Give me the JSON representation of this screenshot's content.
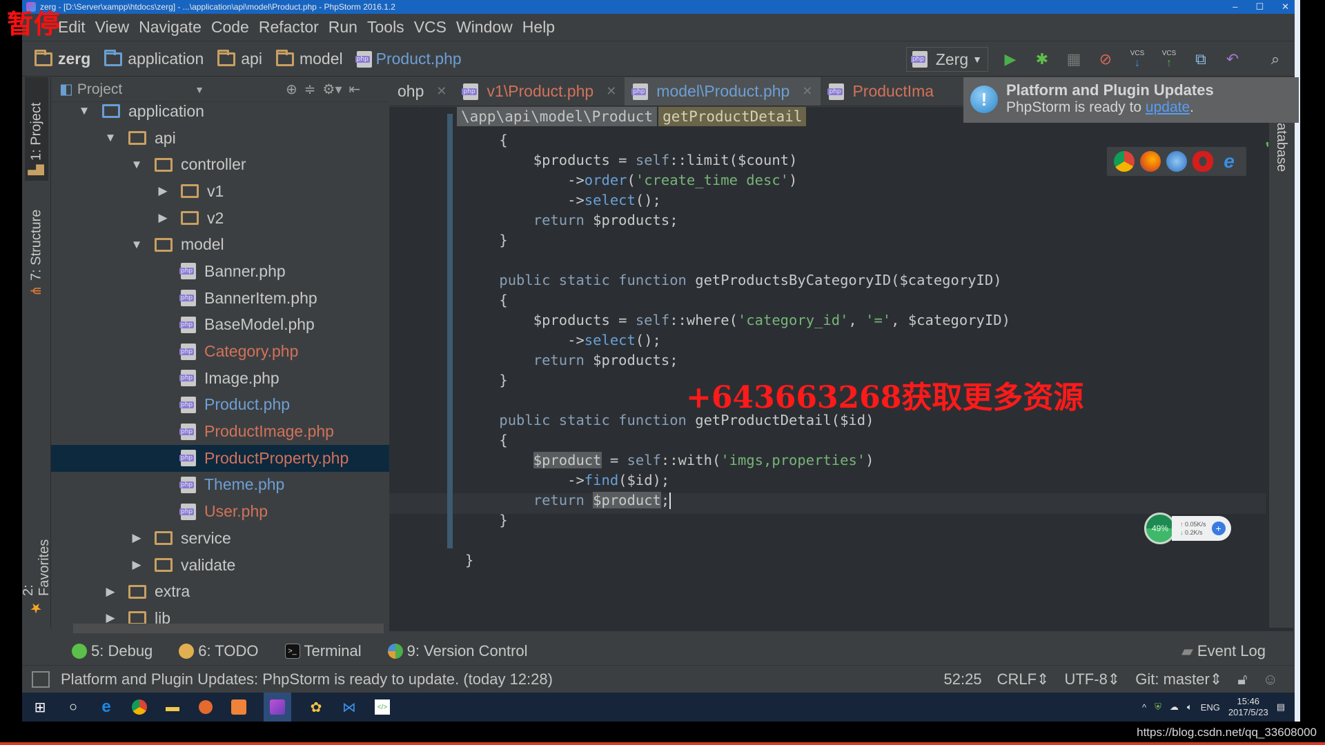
{
  "overlay": {
    "pause_label": "暂停",
    "promo_text": "+643663268获取更多资源",
    "url_watermark": "https://blog.csdn.net/qq_33608000"
  },
  "window": {
    "title": "zerg - [D:\\Server\\xampp\\htdocs\\zerg] - ...\\application\\api\\model\\Product.php - PhpStorm 2016.1.2",
    "controls": [
      "–",
      "☐",
      "✕"
    ]
  },
  "menu": [
    "Edit",
    "View",
    "Navigate",
    "Code",
    "Refactor",
    "Run",
    "Tools",
    "VCS",
    "Window",
    "Help"
  ],
  "breadcrumbs": [
    {
      "label": "zerg",
      "type": "folder"
    },
    {
      "label": "application",
      "type": "folder-blue"
    },
    {
      "label": "api",
      "type": "folder"
    },
    {
      "label": "model",
      "type": "folder"
    },
    {
      "label": "Product.php",
      "type": "file"
    }
  ],
  "toolbar": {
    "run_config": "Zerg",
    "icons": [
      "run-icon",
      "debug-icon",
      "coverage-icon",
      "stop-debug-icon",
      "vcs-update-icon",
      "vcs-commit-icon",
      "history-icon",
      "revert-icon",
      "search-icon"
    ],
    "vcs_label": "VCS"
  },
  "left_strip": {
    "project_tab": "1: Project",
    "structure_tab": "7: Structure",
    "favorites_tab": "2: Favorites"
  },
  "project_panel": {
    "title": "Project",
    "tree": [
      {
        "label": "application",
        "depth": 0,
        "arrow": "▼",
        "kind": "folder-blue",
        "status": "normal"
      },
      {
        "label": "api",
        "depth": 1,
        "arrow": "▼",
        "kind": "folder",
        "status": "normal"
      },
      {
        "label": "controller",
        "depth": 2,
        "arrow": "▼",
        "kind": "folder",
        "status": "normal"
      },
      {
        "label": "v1",
        "depth": 3,
        "arrow": "▶",
        "kind": "folder",
        "status": "normal"
      },
      {
        "label": "v2",
        "depth": 3,
        "arrow": "▶",
        "kind": "folder",
        "status": "normal"
      },
      {
        "label": "model",
        "depth": 2,
        "arrow": "▼",
        "kind": "folder",
        "status": "normal"
      },
      {
        "label": "Banner.php",
        "depth": 3,
        "arrow": "",
        "kind": "php",
        "status": "normal"
      },
      {
        "label": "BannerItem.php",
        "depth": 3,
        "arrow": "",
        "kind": "php",
        "status": "normal"
      },
      {
        "label": "BaseModel.php",
        "depth": 3,
        "arrow": "",
        "kind": "php",
        "status": "normal"
      },
      {
        "label": "Category.php",
        "depth": 3,
        "arrow": "",
        "kind": "php",
        "status": "modified"
      },
      {
        "label": "Image.php",
        "depth": 3,
        "arrow": "",
        "kind": "php",
        "status": "normal"
      },
      {
        "label": "Product.php",
        "depth": 3,
        "arrow": "",
        "kind": "php",
        "status": "changed"
      },
      {
        "label": "ProductImage.php",
        "depth": 3,
        "arrow": "",
        "kind": "php",
        "status": "modified"
      },
      {
        "label": "ProductProperty.php",
        "depth": 3,
        "arrow": "",
        "kind": "php",
        "status": "modified",
        "selected": true
      },
      {
        "label": "Theme.php",
        "depth": 3,
        "arrow": "",
        "kind": "php",
        "status": "changed"
      },
      {
        "label": "User.php",
        "depth": 3,
        "arrow": "",
        "kind": "php",
        "status": "modified"
      },
      {
        "label": "service",
        "depth": 2,
        "arrow": "▶",
        "kind": "folder",
        "status": "normal"
      },
      {
        "label": "validate",
        "depth": 2,
        "arrow": "▶",
        "kind": "folder",
        "status": "normal"
      },
      {
        "label": "extra",
        "depth": 1,
        "arrow": "▶",
        "kind": "folder",
        "status": "normal"
      },
      {
        "label": "lib",
        "depth": 1,
        "arrow": "▶",
        "kind": "folder",
        "status": "normal"
      }
    ]
  },
  "editor_tabs": [
    {
      "label": "ohp",
      "status": "normal",
      "active": false
    },
    {
      "label": "v1\\Product.php",
      "status": "modified",
      "active": false
    },
    {
      "label": "model\\Product.php",
      "status": "changed",
      "active": true
    },
    {
      "label": "ProductIma",
      "status": "modified",
      "active": false
    }
  ],
  "editor": {
    "namespace_crumb": "\\app\\api\\model\\Product",
    "function_crumb": "getProductDetail",
    "cursor_position": "52:25"
  },
  "notification": {
    "title": "Platform and Plugin Updates",
    "body_prefix": "PhpStorm is ready to ",
    "link": "update",
    "body_suffix": "."
  },
  "browsers": [
    "chrome-icon",
    "firefox-icon",
    "safari-icon",
    "opera-icon",
    "ie-icon"
  ],
  "net_widget": {
    "cpu_percent": "49%",
    "upload": "0.05K/s",
    "download": "0.2K/s"
  },
  "right_strip": {
    "database_tab": "atabase"
  },
  "bottom_tools": [
    {
      "label": "5: Debug",
      "icon": "debug-bug-icon"
    },
    {
      "label": "6: TODO",
      "icon": "todo-icon"
    },
    {
      "label": "Terminal",
      "icon": "terminal-icon"
    },
    {
      "label": "9: Version Control",
      "icon": "version-control-icon"
    }
  ],
  "event_log": "Event Log",
  "statusbar": {
    "message": "Platform and Plugin Updates: PhpStorm is ready to update. (today 12:28)",
    "position": "52:25",
    "line_sep": "CRLF⇕",
    "encoding": "UTF-8⇕",
    "vcs": "Git: master⇕"
  },
  "taskbar": {
    "apps": [
      "windows-start-icon",
      "cortana-icon",
      "edge-icon",
      "chrome-icon",
      "explorer-icon",
      "postman-icon",
      "xampp-icon",
      "phpstorm-icon",
      "app-yellow-icon",
      "vscode-icon",
      "code-editor-icon"
    ],
    "tray_lang": "ENG",
    "time": "15:46",
    "date": "2017/5/23"
  }
}
